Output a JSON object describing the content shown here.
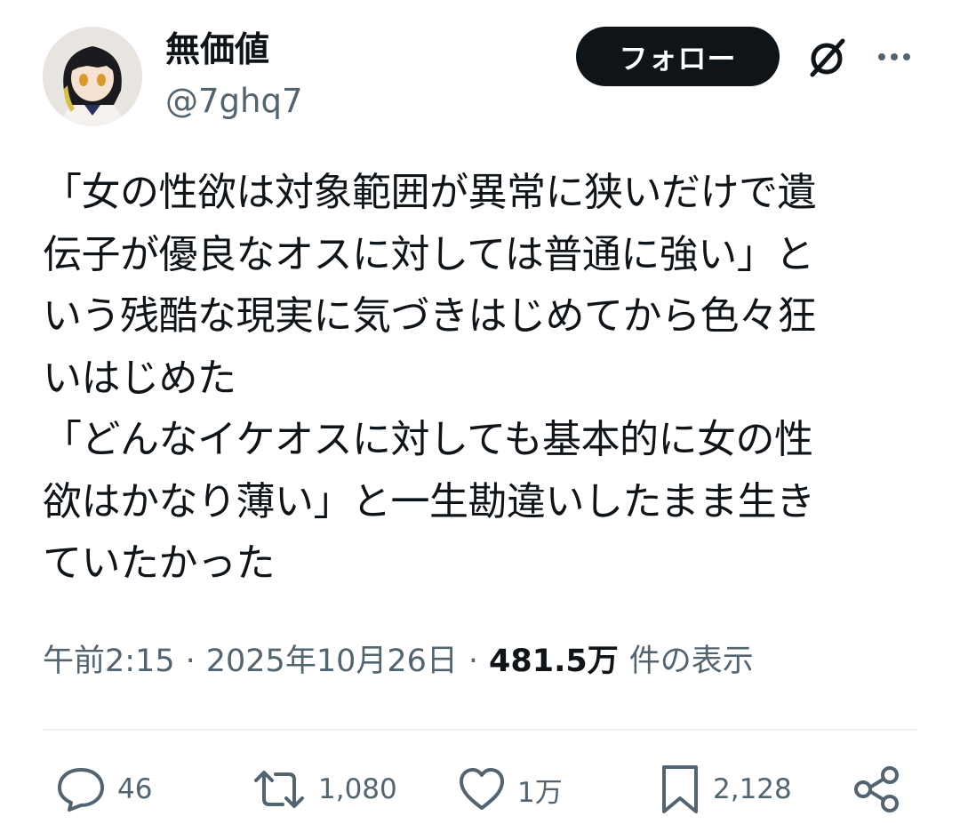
{
  "author": {
    "display_name": "無価値",
    "handle": "@7ghq7"
  },
  "follow_button_label": "フォロー",
  "tweet": {
    "lines": [
      "「女の性欲は対象範囲が異常に狭いだけで遺",
      "伝子が優良なオスに対しては普通に強い」と",
      "いう残酷な現実に気づきはじめてから色々狂",
      "いはじめた",
      "「どんなイケオスに対しても基本的に女の性",
      "欲はかなり薄い」と一生勘違いしたまま生き",
      "ていたかった"
    ]
  },
  "meta": {
    "time": "午前2:15",
    "separator": "·",
    "date": "2025年10月26日",
    "views_count": "481.5万",
    "views_label": "件の表示"
  },
  "actions": {
    "replies": "46",
    "retweets": "1,080",
    "likes": "1万",
    "bookmarks": "2,128"
  },
  "colors": {
    "text_primary": "#0f1419",
    "text_secondary": "#536471",
    "follow_bg": "#0f1419",
    "divider": "#eff3f4"
  },
  "icons": [
    "grok-icon",
    "more-icon",
    "reply-icon",
    "retweet-icon",
    "like-icon",
    "bookmark-icon",
    "share-icon"
  ]
}
